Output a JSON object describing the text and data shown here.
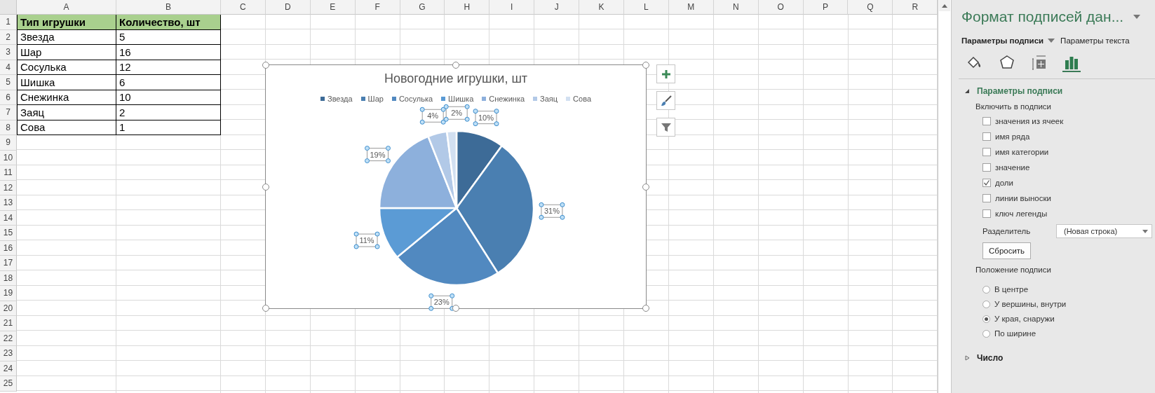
{
  "sheet": {
    "columns": [
      "A",
      "B",
      "C",
      "D",
      "E",
      "F",
      "G",
      "H",
      "I",
      "J",
      "K",
      "L",
      "M",
      "N",
      "O",
      "P",
      "Q",
      "R"
    ],
    "rows": [
      "1",
      "2",
      "3",
      "4",
      "5",
      "6",
      "7",
      "8",
      "9",
      "10",
      "11",
      "12",
      "13",
      "14",
      "15",
      "16",
      "17",
      "18",
      "19",
      "20",
      "21",
      "22",
      "23",
      "24",
      "25"
    ],
    "table": {
      "header": [
        "Тип игрушки",
        "Количество, шт"
      ],
      "rows": [
        [
          "Звезда",
          "5"
        ],
        [
          "Шар",
          "16"
        ],
        [
          "Сосулька",
          "12"
        ],
        [
          "Шишка",
          "6"
        ],
        [
          "Снежинка",
          "10"
        ],
        [
          "Заяц",
          "2"
        ],
        [
          "Сова",
          "1"
        ]
      ]
    }
  },
  "chart": {
    "selected": true,
    "labels_selected": true,
    "chart_data": {
      "type": "pie",
      "title": "Новогодние игрушки, шт",
      "categories": [
        "Звезда",
        "Шар",
        "Сосулька",
        "Шишка",
        "Снежинка",
        "Заяц",
        "Сова"
      ],
      "values": [
        10,
        31,
        23,
        11,
        19,
        4,
        2
      ],
      "value_labels": [
        "10%",
        "31%",
        "23%",
        "11%",
        "19%",
        "4%",
        "2%"
      ]
    }
  },
  "panel": {
    "title": "Формат подписей дан...",
    "tabs": [
      {
        "label": "Параметры подписи",
        "selected": true
      },
      {
        "label": "Параметры текста",
        "selected": false
      }
    ],
    "icon_tabs": [
      {
        "kind": "fill",
        "selected": false
      },
      {
        "kind": "effects",
        "selected": false
      },
      {
        "kind": "size",
        "selected": false
      },
      {
        "kind": "options",
        "selected": true
      }
    ],
    "sections": [
      {
        "title": "Параметры подписи",
        "expanded": true
      },
      {
        "title": "Число",
        "expanded": false
      }
    ],
    "include_label": "Включить в подписи",
    "options": [
      {
        "label": "значения из ячеек",
        "checked": false
      },
      {
        "label": "имя ряда",
        "checked": false
      },
      {
        "label": "имя категории",
        "checked": false
      },
      {
        "label": "значение",
        "checked": false
      },
      {
        "label": "доли",
        "checked": true
      },
      {
        "label": "линии выноски",
        "checked": false
      },
      {
        "label": "ключ легенды",
        "checked": false
      }
    ],
    "separator": {
      "label": "Разделитель",
      "value": "(Новая строка)"
    },
    "reset_button": "Сбросить",
    "position_label": "Положение подписи",
    "positions": [
      {
        "label": "В центре",
        "selected": false
      },
      {
        "label": "У вершины, внутри",
        "selected": false
      },
      {
        "label": "У края, снаружи",
        "selected": true
      },
      {
        "label": "По ширине",
        "selected": false
      }
    ]
  }
}
